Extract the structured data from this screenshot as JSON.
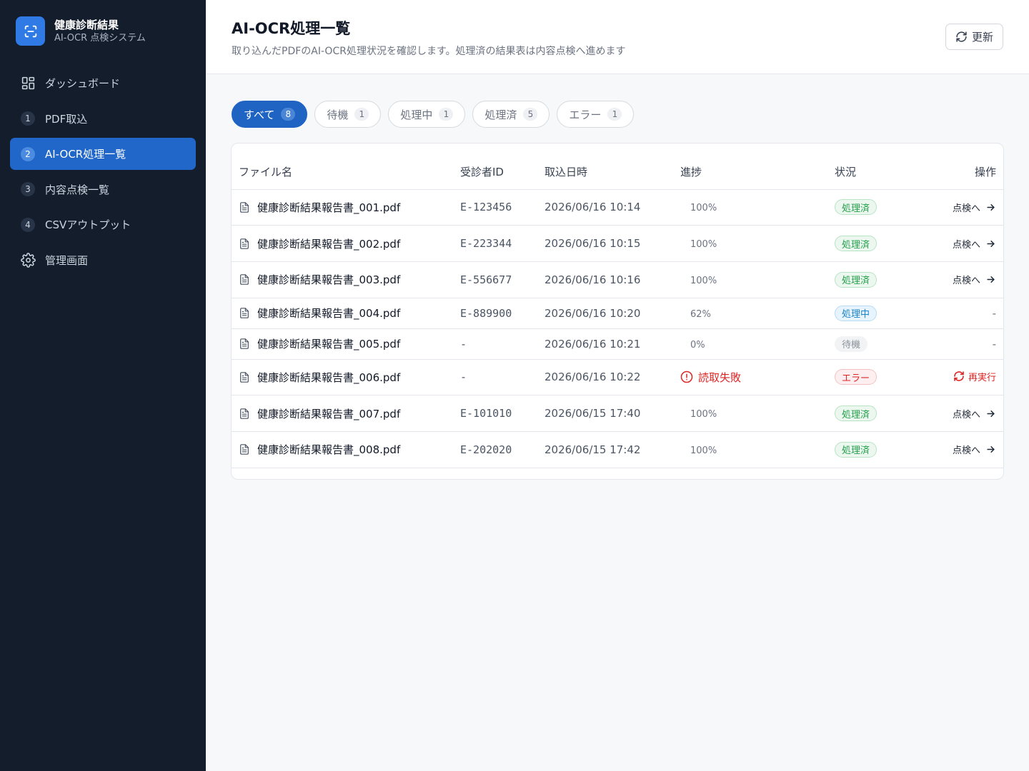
{
  "brand": {
    "title": "健康診断結果",
    "subtitle": "AI-OCR 点検システム",
    "icon": "scan-icon",
    "color": "#2f7ae5"
  },
  "nav": {
    "items": [
      {
        "icon": "dashboard-grid-icon",
        "label": "ダッシュボード"
      },
      {
        "num": "1",
        "label": "PDF取込"
      },
      {
        "num": "2",
        "label": "AI-OCR処理一覧",
        "active": true
      },
      {
        "num": "3",
        "label": "内容点検一覧"
      },
      {
        "num": "4",
        "label": "CSVアウトプット"
      },
      {
        "icon": "gear-icon",
        "label": "管理画面"
      }
    ]
  },
  "header": {
    "title": "AI-OCR処理一覧",
    "description": "取り込んだPDFのAI-OCR処理状況を確認します。処理済の結果表は内容点検へ進めます",
    "refresh_label": "更新"
  },
  "tabs": [
    {
      "label": "すべて",
      "count": "8",
      "active": true
    },
    {
      "label": "待機",
      "count": "1"
    },
    {
      "label": "処理中",
      "count": "1"
    },
    {
      "label": "処理済",
      "count": "5"
    },
    {
      "label": "エラー",
      "count": "1"
    }
  ],
  "table": {
    "columns": [
      "ファイル名",
      "受診者ID",
      "取込日時",
      "進捗",
      "状況",
      "操作"
    ],
    "rows": [
      {
        "file": "健康診断結果報告書_001.pdf",
        "id": "E-123456",
        "date": "2026/06/16 10:14",
        "progress": "100%",
        "status": "処理済",
        "action": "点検へ"
      },
      {
        "file": "健康診断結果報告書_002.pdf",
        "id": "E-223344",
        "date": "2026/06/16 10:15",
        "progress": "100%",
        "status": "処理済",
        "action": "点検へ"
      },
      {
        "file": "健康診断結果報告書_003.pdf",
        "id": "E-556677",
        "date": "2026/06/16 10:16",
        "progress": "100%",
        "status": "処理済",
        "action": "点検へ"
      },
      {
        "file": "健康診断結果報告書_004.pdf",
        "id": "E-889900",
        "date": "2026/06/16 10:20",
        "progress": "62%",
        "status": "処理中",
        "action": "-"
      },
      {
        "file": "健康診断結果報告書_005.pdf",
        "id": "-",
        "date": "2026/06/16 10:21",
        "progress": "0%",
        "status": "待機",
        "action": "-"
      },
      {
        "file": "健康診断結果報告書_006.pdf",
        "id": "-",
        "date": "2026/06/16 10:22",
        "progress": "読取失敗",
        "status": "エラー",
        "action": "再実行"
      },
      {
        "file": "健康診断結果報告書_007.pdf",
        "id": "E-101010",
        "date": "2026/06/15 17:40",
        "progress": "100%",
        "status": "処理済",
        "action": "点検へ"
      },
      {
        "file": "健康診断結果報告書_008.pdf",
        "id": "E-202020",
        "date": "2026/06/15 17:42",
        "progress": "100%",
        "status": "処理済",
        "action": "点検へ"
      }
    ]
  },
  "colors": {
    "sidebar_bg": "#141d2c",
    "accent": "#2167c9",
    "done": "#22a04a",
    "processing": "#1a84c9",
    "error": "#dc2626"
  }
}
